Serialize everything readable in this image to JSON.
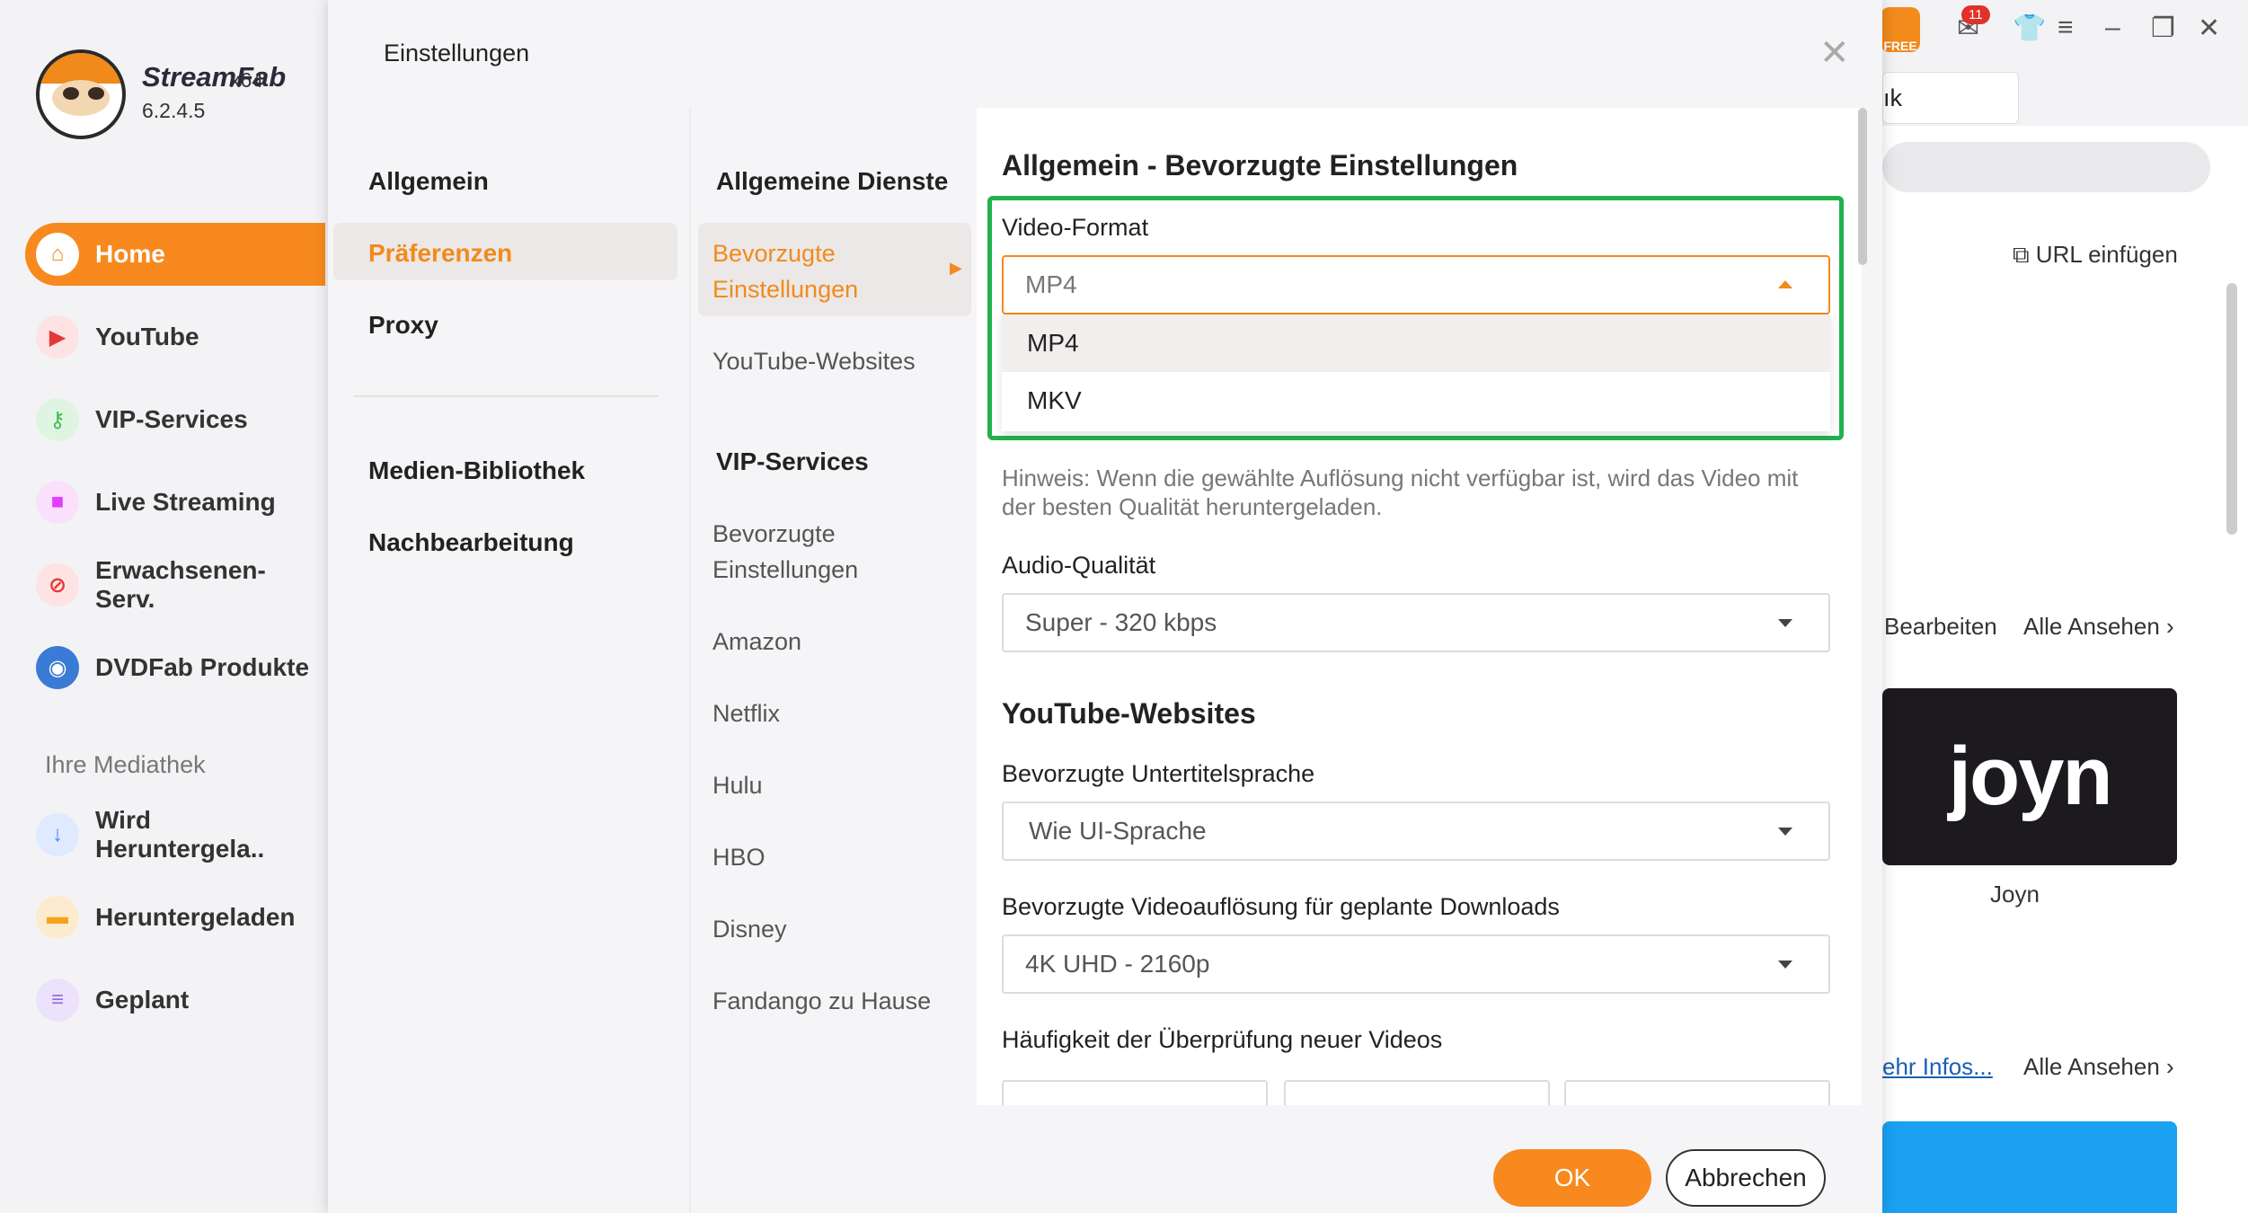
{
  "app": {
    "name": "StreamFab",
    "arch": "x64",
    "version": "6.2.4.5"
  },
  "sidebar": {
    "items": [
      {
        "label": "Home",
        "icon": "home-icon",
        "color": "#f7891f"
      },
      {
        "label": "YouTube",
        "icon": "youtube-icon",
        "color": "#e53935"
      },
      {
        "label": "VIP-Services",
        "icon": "key-icon",
        "color": "#3fbf4f"
      },
      {
        "label": "Live Streaming",
        "icon": "camera-icon",
        "color": "#e040fb"
      },
      {
        "label": "Erwachsenen-Serv.",
        "icon": "restricted-icon",
        "color": "#e53935"
      },
      {
        "label": "DVDFab Produkte",
        "icon": "dvdfab-icon",
        "color": "#3a7bd5"
      }
    ],
    "library_heading": "Ihre Mediathek",
    "library": [
      {
        "label": "Wird Heruntergela..",
        "icon": "download-icon",
        "color": "#3a86ff"
      },
      {
        "label": "Heruntergeladen",
        "icon": "folder-icon",
        "color": "#f7a21b"
      },
      {
        "label": "Geplant",
        "icon": "list-icon",
        "color": "#9b6ddf"
      }
    ]
  },
  "topbar": {
    "free_label": "FREE",
    "notification_count": "11"
  },
  "background": {
    "tab_label": "ık",
    "url_insert": "URL einfügen",
    "edit": "Bearbeiten",
    "see_all": "Alle Ansehen",
    "joyn_logo": "joyn",
    "joyn_label": "Joyn",
    "more_info": "ehr Infos..."
  },
  "dialog": {
    "title": "Einstellungen",
    "categories": [
      "Allgemein",
      "Präferenzen",
      "Proxy",
      "Medien-Bibliothek",
      "Nachbearbeitung"
    ],
    "services": {
      "general_heading": "Allgemeine Dienste",
      "general": [
        "Bevorzugte Einstellungen",
        "YouTube-Websites"
      ],
      "vip_heading": "VIP-Services",
      "vip": [
        "Bevorzugte Einstellungen",
        "Amazon",
        "Netflix",
        "Hulu",
        "HBO",
        "Disney",
        "Fandango zu Hause"
      ]
    },
    "content": {
      "section1_title": "Allgemein - Bevorzugte Einstellungen",
      "video_format_label": "Video-Format",
      "video_format_value": "MP4",
      "video_format_options": [
        "MP4",
        "MKV"
      ],
      "hint": "Hinweis: Wenn die gewählte Auflösung nicht verfügbar ist, wird das Video mit der besten Qualität heruntergeladen.",
      "audio_label": "Audio-Qualität",
      "audio_value": "Super - 320 kbps",
      "section2_title": "YouTube-Websites",
      "subtitle_label": "Bevorzugte Untertitelsprache",
      "subtitle_value": "Wie UI-Sprache",
      "resolution_label": "Bevorzugte Videoauflösung für geplante Downloads",
      "resolution_value": "4K UHD - 2160p",
      "frequency_label": "Häufigkeit der Überprüfung neuer Videos"
    },
    "ok_label": "OK",
    "cancel_label": "Abbrechen",
    "accent_color": "#f7891f",
    "highlight_color": "#23b14d"
  }
}
